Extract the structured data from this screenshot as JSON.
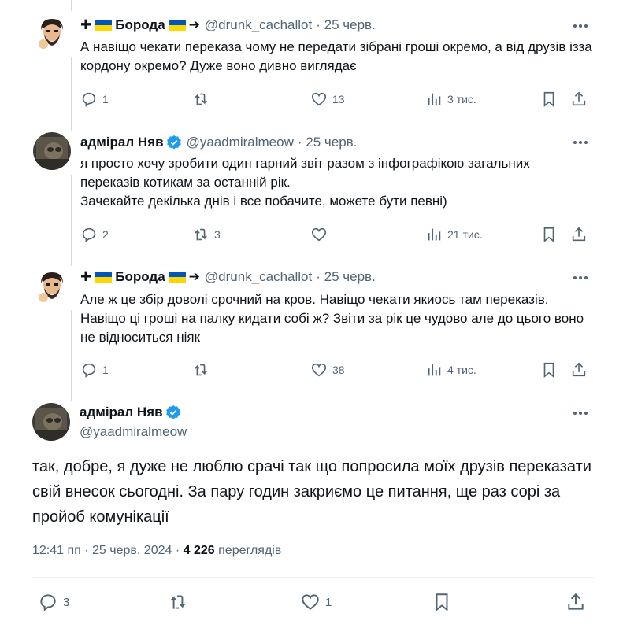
{
  "replies": [
    {
      "name_prefix": "✚",
      "name": "Борода",
      "name_suffix": "➔",
      "handle": "@drunk_cachallot",
      "date": "· 25 черв.",
      "text": "А навіщо чекати переказа чому не передати зібрані гроші окремо, а від друзів ізза кордону окремо? Дуже воно дивно виглядає",
      "replies": "1",
      "reposts": "",
      "likes": "13",
      "views": "3 тис."
    },
    {
      "name": "адмірал Няв",
      "handle": "@yaadmiralmeow",
      "date": "· 25 черв.",
      "text_line1": "я просто хочу зробити один гарний звіт разом з інфографікою загальних переказів котикам за останній рік.",
      "text_line2": "Зачекайте декілька днів і все побачите, можете бути певні)",
      "replies": "2",
      "reposts": "3",
      "likes": "",
      "views": "21 тис."
    },
    {
      "name_prefix": "✚",
      "name": "Борода",
      "name_suffix": "➔",
      "handle": "@drunk_cachallot",
      "date": "· 25 черв.",
      "text": "Але ж це збір доволі срочний на кров. Навіщо чекати якиось там переказів. Навіщо ці гроші на палку кидати собі ж? Звіти за рік це чудово але до цього воно не відноситься ніяк",
      "replies": "1",
      "reposts": "",
      "likes": "38",
      "views": "4 тис."
    }
  ],
  "main_tweet": {
    "name": "адмірал Няв",
    "handle": "@yaadmiralmeow",
    "text": "так, добре, я дуже не люблю срачі так що попросила моїх друзів переказати свій внесок сьогодні. За пару годин закриємо це питання, ще раз сорі за пройоб комунікації",
    "time": "12:41 пп · 25 черв. 2024 ·",
    "views_count": "4 226",
    "views_label": "переглядів",
    "replies": "3",
    "reposts": "",
    "likes": "1"
  },
  "colors": {
    "text": "#0f1419",
    "muted": "#536471",
    "verified": "#1d9bf0",
    "flag_blue": "#0057b7",
    "flag_yellow": "#ffd700"
  },
  "icons": [
    "more-icon",
    "reply-icon",
    "repost-icon",
    "like-icon",
    "views-icon",
    "bookmark-icon",
    "share-icon",
    "verified-badge-icon"
  ]
}
